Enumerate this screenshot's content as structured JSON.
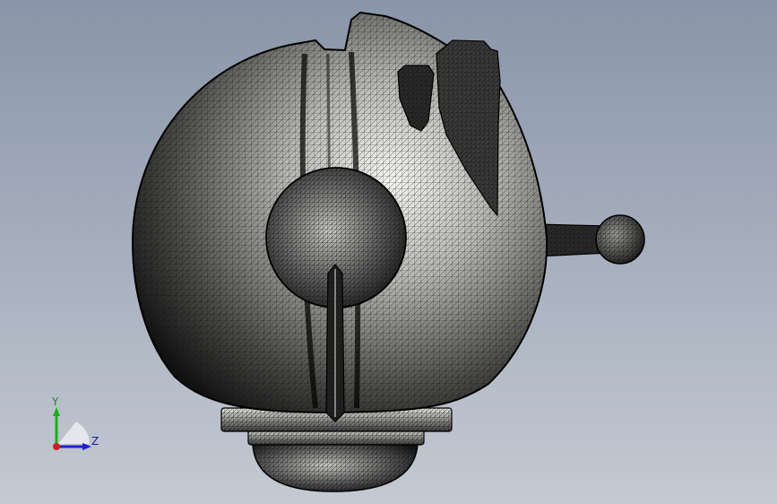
{
  "viewport": {
    "background_top": "#8995a8",
    "background_bottom": "#c4cad3",
    "render_style": "wireframe mesh with shaded surfaces"
  },
  "model": {
    "stroke_color": "#111111",
    "surface_light": "#f2f2f0",
    "surface_dark": "#1a1a1a"
  },
  "triad": {
    "y_label": "Y",
    "z_label": "Z",
    "y_color": "#1faa1f",
    "z_color": "#1f1fd0",
    "x_color": "#d01f1f"
  }
}
